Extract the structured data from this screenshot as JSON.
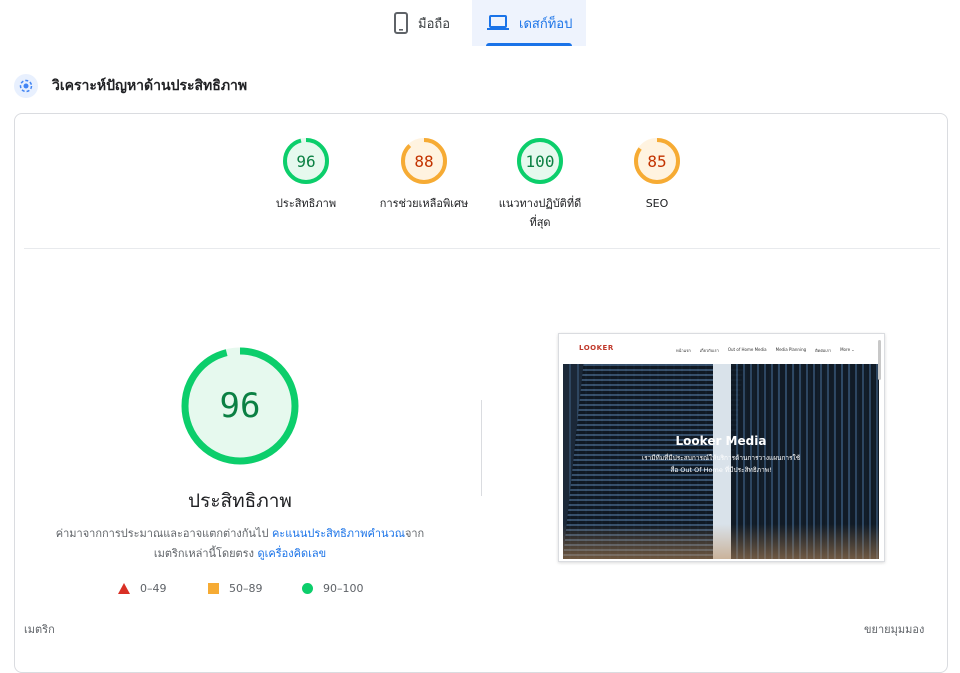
{
  "device_tabs": {
    "mobile": "มือถือ",
    "desktop": "เดสก์ท็อป",
    "selected": "desktop"
  },
  "section": {
    "title": "วิเคราะห์ปัญหาด้านประสิทธิภาพ",
    "icon": "performance-diagnose-icon"
  },
  "scores": [
    {
      "value": "96",
      "label_line1": "ประสิทธิภาพ",
      "label_line2": "",
      "color": "#0cce6b",
      "text_color": "#0b8043",
      "fraction": 0.96
    },
    {
      "value": "88",
      "label_line1": "การช่วยเหลือพิเศษ",
      "label_line2": "",
      "color": "#f6ab34",
      "text_color": "#c33300",
      "fraction": 0.88
    },
    {
      "value": "100",
      "label_line1": "แนวทางปฏิบัติที่ดี",
      "label_line2": "ที่สุด",
      "color": "#0cce6b",
      "text_color": "#0b8043",
      "fraction": 1.0
    },
    {
      "value": "85",
      "label_line1": "SEO",
      "label_line2": "",
      "color": "#f6ab34",
      "text_color": "#c33300",
      "fraction": 0.85
    }
  ],
  "main_score": {
    "value": "96",
    "fraction": 0.96,
    "title": "ประสิทธิภาพ",
    "note_prefix": "ค่ามาจากการประมาณและอาจแตกต่างกันไป",
    "note_link1": "คะแนนประสิทธิภาพคำนวณ",
    "note_mid": "จาก",
    "note_line2_prefix": "เมตริกเหล่านี้โดยตรง",
    "note_link2": "ดูเครื่องคิดเลข"
  },
  "legend": [
    {
      "shape": "triangle",
      "label": "0–49",
      "color": "#d93025"
    },
    {
      "shape": "square",
      "label": "50–89",
      "color": "#f6ab34"
    },
    {
      "shape": "circle",
      "label": "90–100",
      "color": "#0cce6b"
    }
  ],
  "footer": {
    "metrics_label": "เมตริก",
    "expand_label": "ขยายมุมมอง"
  },
  "screenshot": {
    "logo": "LOOKER",
    "menu": [
      "หน้าแรก",
      "เกี่ยวกับเรา",
      "Out of Home Media",
      "Media Planning",
      "ติดต่อเรา",
      "More ⌄"
    ],
    "hero_title": "Looker Media",
    "hero_text": "เรามีทีมที่มีประสบการณ์ให้บริการด้านการวางแผนการใช้สื่อ Out Of Home ที่มีประสิทธิภาพ!"
  }
}
